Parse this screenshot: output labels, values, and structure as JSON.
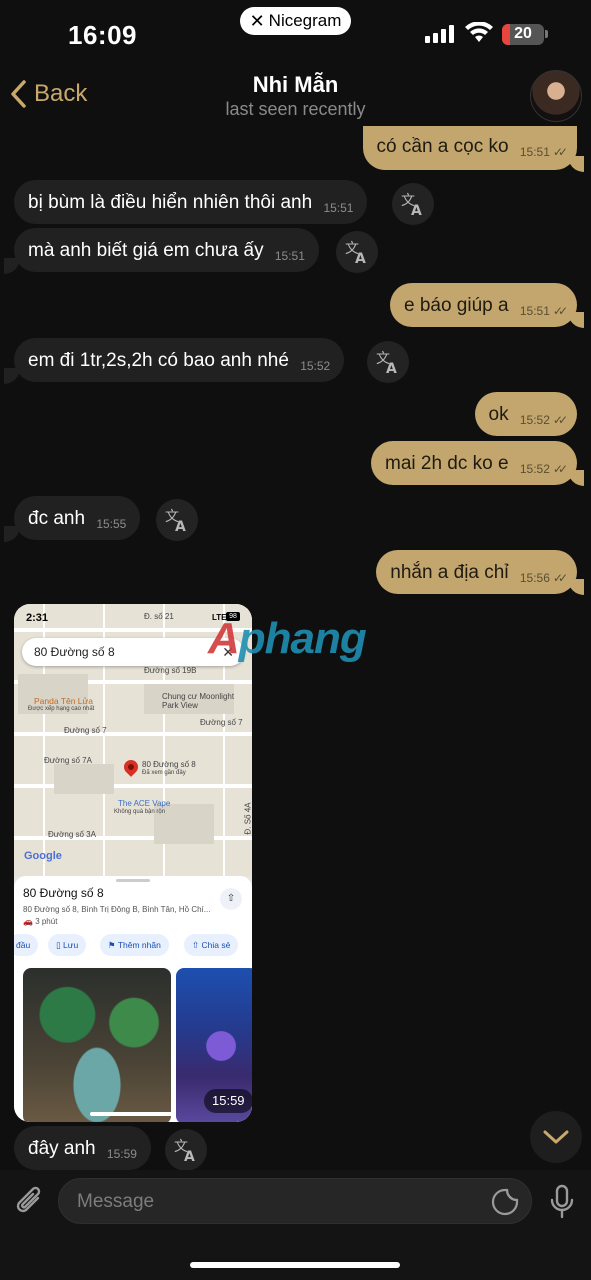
{
  "status_bar": {
    "time": "16:09",
    "app_badge": "Nicegram",
    "battery": "20",
    "battery_level": 0.2
  },
  "header": {
    "back_label": "Back",
    "contact_name": "Nhi Mẫn",
    "contact_status": "last seen recently"
  },
  "messages": [
    {
      "dir": "out",
      "text": "có cần a cọc ko",
      "time": "15:51"
    },
    {
      "dir": "in",
      "text": "bị bùm là điều hiển nhiên thôi anh",
      "time": "15:51"
    },
    {
      "dir": "in",
      "text": "mà anh biết giá em chưa ấy",
      "time": "15:51"
    },
    {
      "dir": "out",
      "text": "e báo giúp a",
      "time": "15:51"
    },
    {
      "dir": "in",
      "text": "em đi 1tr,2s,2h có bao anh nhé",
      "time": "15:52"
    },
    {
      "dir": "out",
      "text": "ok",
      "time": "15:52"
    },
    {
      "dir": "out",
      "text": "mai 2h dc ko e",
      "time": "15:52"
    },
    {
      "dir": "in",
      "text": "đc anh",
      "time": "15:55"
    },
    {
      "dir": "out",
      "text": "nhắn a địa chỉ",
      "time": "15:56"
    },
    {
      "dir": "in",
      "text": "đây anh",
      "time": "15:59"
    }
  ],
  "screenshot_message": {
    "time": "15:59",
    "phone_time": "2:31",
    "phone_net": "LTE",
    "phone_battery": "98",
    "search_text": "80 Đường số 8",
    "map_labels": {
      "road_7": "Đường số 7",
      "road_7_b": "Đường số 7",
      "road_7a": "Đường số 7A",
      "road_3a": "Đường số 3A",
      "road_19b": "Đường số 19B",
      "road_21": "Đ. số 21",
      "road_4a": "Đ. Số 4A",
      "poi_panda": "Panda Tên Lửa",
      "poi_panda_sub": "Được xếp hạng cao nhất",
      "poi_moonlight": "Chung cư Moonlight Park View",
      "poi_pin": "80 Đường số 8",
      "poi_pin_sub": "Đã xem gần đây",
      "poi_ace": "The ACE Vape",
      "poi_ace_sub": "Không quá bận rộn",
      "google": "Google"
    },
    "place_name": "80 Đường số 8",
    "place_address": "80 Đường số 8, Bình Trị Đông B, Bình Tân, Hồ Chí...",
    "place_time": "3 phút",
    "chips": [
      "đầu",
      "Lưu",
      "Thêm nhãn",
      "Chia sẻ"
    ]
  },
  "watermark": {
    "part1": "A",
    "part2": "phang"
  },
  "composer": {
    "placeholder": "Message"
  },
  "colors": {
    "outgoing_bubble": "#c2a66d",
    "incoming_bubble": "#212121",
    "accent": "#c9a96b",
    "background": "#0f0f0f"
  },
  "icons": [
    "chevron-left-icon",
    "translate-icon",
    "paperclip-icon",
    "sticker-icon",
    "microphone-icon",
    "chevron-down-icon",
    "wifi-icon",
    "signal-icon",
    "battery-icon"
  ]
}
